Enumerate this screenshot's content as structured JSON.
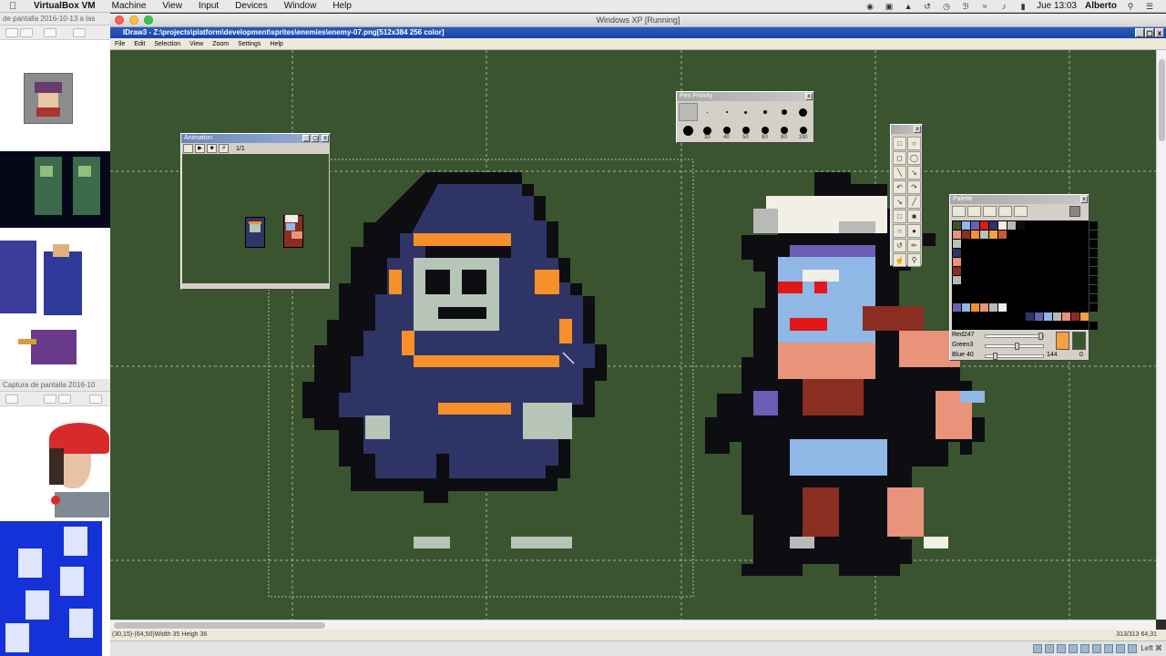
{
  "mac_menubar": {
    "app_name": "VirtualBox VM",
    "menus": [
      "Machine",
      "View",
      "Input",
      "Devices",
      "Window",
      "Help"
    ],
    "clock": "Jue 13:03",
    "user": "Alberto"
  },
  "vbox_window": {
    "title": "Windows XP [Running]",
    "host_key": "Left ⌘"
  },
  "finder": {
    "top_title": "de pantalla 2016-10-13 a las",
    "second_title": "Captura de pantalla 2016-10"
  },
  "app": {
    "title": "IDraw3 - Z:\\projects\\platform\\development\\sprites\\enemies\\enemy-07.png[512x384 256 color]",
    "menus": [
      "File",
      "Edit",
      "Selection",
      "View",
      "Zoom",
      "Settings",
      "Help"
    ],
    "status_left": "(30,15)-(64,50)Width 35 Heigh 36",
    "status_right": "313/313      64,31"
  },
  "animation_window": {
    "title": "Animation",
    "frame": "1/1"
  },
  "pen_window": {
    "title": "Pen Priority",
    "sizes": [
      "",
      "",
      "",
      "",
      "",
      "",
      "",
      "",
      "30",
      "40",
      "50",
      "60",
      "80",
      "100"
    ]
  },
  "palette_window": {
    "title": "Palette",
    "red_label": "Red247",
    "green_label": "Green3",
    "blue_label": "Blue  40",
    "index": "144",
    "index2": "0",
    "selected_color": "#f7a040"
  },
  "colors": {
    "canvas_bg": "#3a5430",
    "hood_blue": "#2f3466",
    "orange": "#f7902a",
    "skull": "#b7c4b8"
  }
}
